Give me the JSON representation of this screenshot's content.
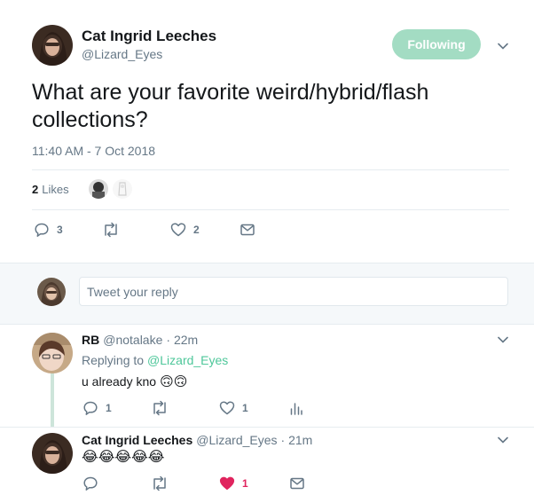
{
  "colors": {
    "accent": "#1da1f2",
    "follow_button": "#8fd3f5",
    "muted": "#657786",
    "like_active": "#e0245e",
    "divider": "#e6ecf0",
    "reply_band": "#f5f8fa",
    "thread_line": "#cde5da"
  },
  "main_tweet": {
    "author_name": "Cat Ingrid Leeches",
    "author_handle": "@Lizard_Eyes",
    "follow_label": "Following",
    "text": "What are your favorite weird/hybrid/flash collections?",
    "timestamp": "11:40 AM - 7 Oct 2018",
    "likes_count": "2",
    "likes_label": "Likes",
    "actions": {
      "reply_count": "3",
      "retweet_count": "",
      "like_count": "2"
    }
  },
  "reply_box": {
    "placeholder": "Tweet your reply"
  },
  "replies": [
    {
      "author_name": "RB",
      "author_handle": "@notalake",
      "time": "· 22m",
      "replying_to_label": "Replying to",
      "replying_to_handle": "@Lizard_Eyes",
      "text": "u already kno",
      "emoji": "🙃🙃",
      "actions": {
        "reply_count": "1",
        "like_count": "1"
      }
    },
    {
      "author_name": "Cat Ingrid Leeches",
      "author_handle": "@Lizard_Eyes",
      "time": "· 21m",
      "text": "😂😂😂😂😂",
      "actions": {
        "like_count": "1",
        "liked": true
      }
    }
  ]
}
